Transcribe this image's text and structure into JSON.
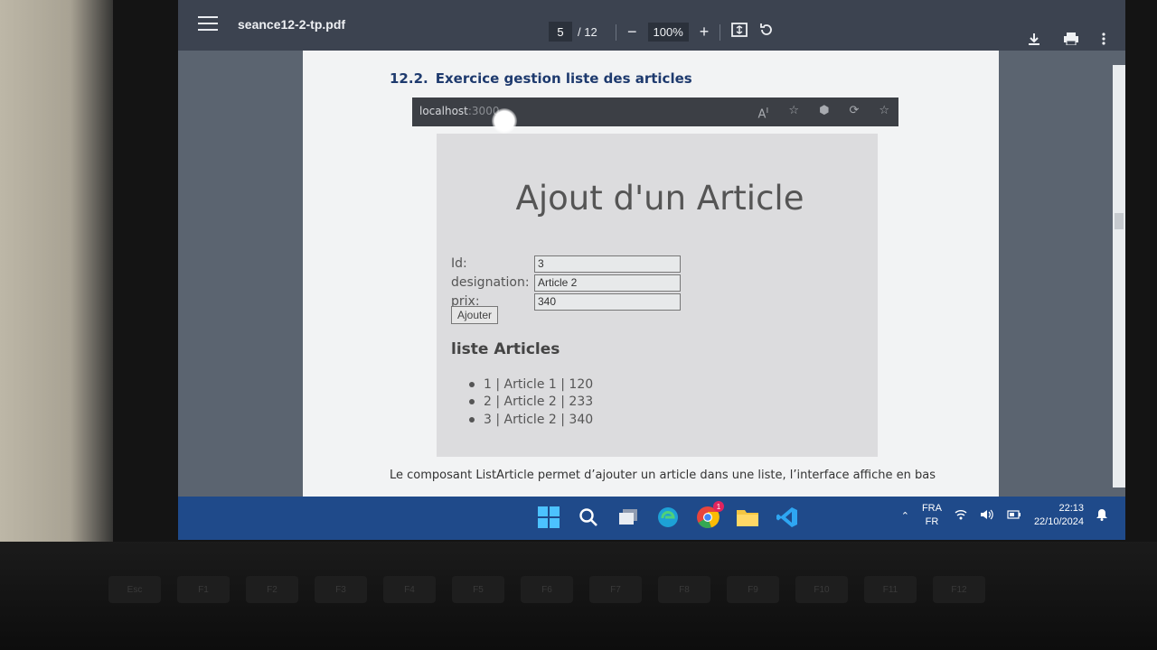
{
  "pdf_viewer": {
    "file_name": "seance12-2-tp.pdf",
    "current_page": "5",
    "page_total": "/ 12",
    "zoom": "100%"
  },
  "document": {
    "section_number": "12.2.",
    "section_title": "Exercice gestion liste des articles",
    "description_line": "Le composant ListArticle permet d’ajouter un article dans une liste, l’interface affiche en bas"
  },
  "embedded_browser": {
    "address_host": "localhost",
    "address_port": ":3000"
  },
  "app": {
    "title": "Ajout d'un Article",
    "form": {
      "id_label": "Id:",
      "id_value": "3",
      "designation_label": "designation:",
      "designation_value": "Article 2",
      "prix_label": "prix:",
      "prix_value": "340",
      "submit_label": "Ajouter"
    },
    "list_title": "liste Articles",
    "articles": [
      "1 | Article 1 | 120",
      "2 | Article 2 | 233",
      "3 | Article 2 | 340"
    ]
  },
  "taskbar": {
    "lang_primary": "FRA",
    "lang_secondary": "FR",
    "time": "22:13",
    "date": "22/10/2024",
    "chrome_badge": "1"
  },
  "keyboard": {
    "fn_keys": [
      "Esc",
      "F1",
      "F2",
      "F3",
      "F4",
      "F5",
      "F6",
      "F7",
      "F8",
      "F9",
      "F10",
      "F11",
      "F12"
    ]
  },
  "colors": {
    "toolbar_bg": "#3c4350",
    "heading_blue": "#1e3a6e",
    "taskbar_bg": "#1f4a8a"
  }
}
